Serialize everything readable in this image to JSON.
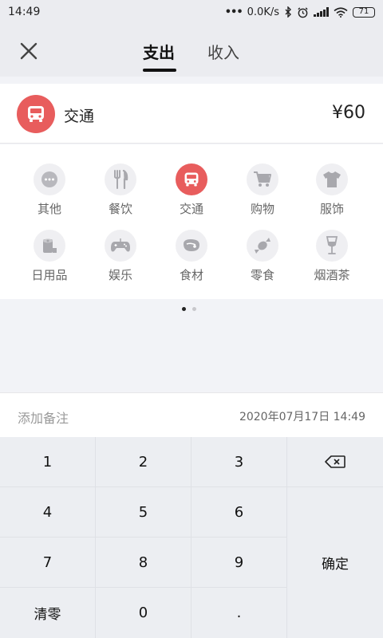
{
  "status_bar": {
    "time": "14:49",
    "network_speed": "0.0K/s",
    "battery": "71"
  },
  "nav": {
    "tab_expense": "支出",
    "tab_income": "收入",
    "active_tab": "expense"
  },
  "selected": {
    "category": "交通",
    "icon": "bus-icon",
    "amount": "¥60",
    "accent_color": "#e85d5d"
  },
  "categories": [
    {
      "label": "其他",
      "icon": "more-dots-icon"
    },
    {
      "label": "餐饮",
      "icon": "fork-knife-icon"
    },
    {
      "label": "交通",
      "icon": "bus-icon",
      "active": true
    },
    {
      "label": "购物",
      "icon": "shopping-cart-icon"
    },
    {
      "label": "服饰",
      "icon": "shirt-icon"
    },
    {
      "label": "日用品",
      "icon": "tissue-roll-icon"
    },
    {
      "label": "娱乐",
      "icon": "gamepad-icon"
    },
    {
      "label": "食材",
      "icon": "meat-icon"
    },
    {
      "label": "零食",
      "icon": "candy-icon"
    },
    {
      "label": "烟酒茶",
      "icon": "wine-glass-icon"
    }
  ],
  "note": {
    "placeholder": "添加备注",
    "date": "2020年07月17日 14:49"
  },
  "keypad": {
    "k1": "1",
    "k2": "2",
    "k3": "3",
    "k4": "4",
    "k5": "5",
    "k6": "6",
    "k7": "7",
    "k8": "8",
    "k9": "9",
    "clear": "清零",
    "k0": "0",
    "dot": ".",
    "confirm": "确定",
    "backspace_icon": "backspace-icon"
  }
}
